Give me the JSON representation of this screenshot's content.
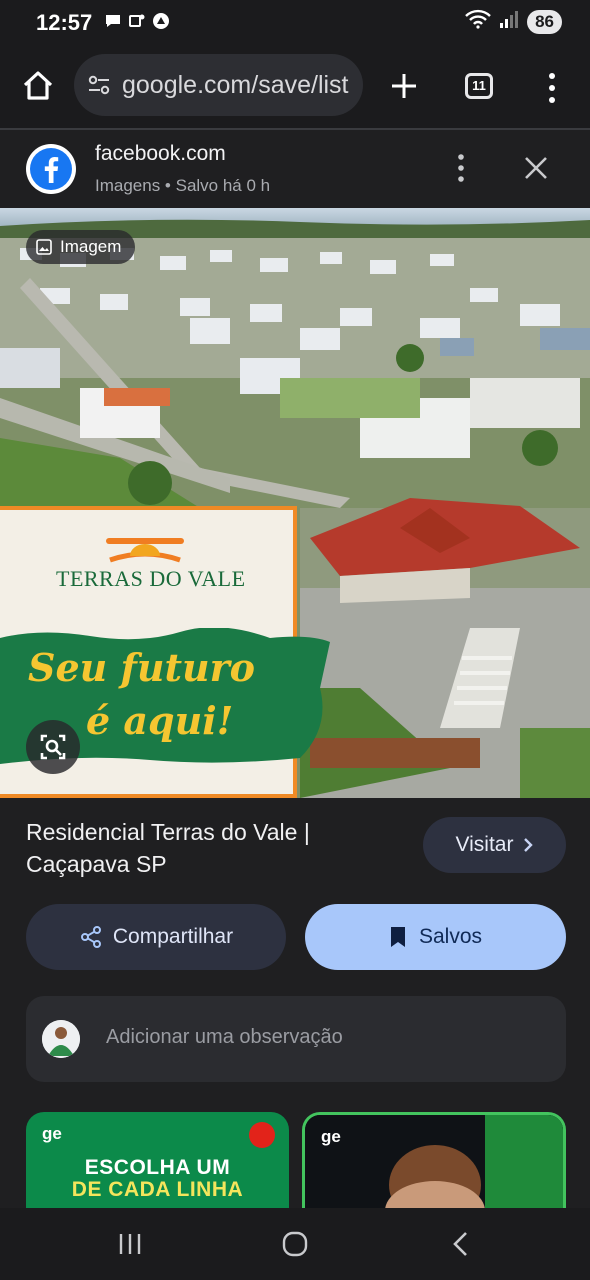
{
  "status_bar": {
    "time": "12:57",
    "battery": "86",
    "icons": [
      "chat-bubble-icon",
      "teams-icon",
      "app-icon",
      "wifi-icon",
      "signal-icon"
    ]
  },
  "browser": {
    "url": "google.com/save/list",
    "tab_count": "11"
  },
  "source": {
    "name": "facebook.com",
    "subtitle": "Imagens • Salvo há 0 h"
  },
  "image": {
    "chip_label": "Imagem",
    "brand": "TERRAS DO VALE",
    "slogan_line1": "Seu futuro",
    "slogan_line2": "é aqui!"
  },
  "item": {
    "title": "Residencial Terras do Vale | Caçapava SP",
    "visit_label": "Visitar",
    "share_label": "Compartilhar",
    "saved_label": "Salvos",
    "note_placeholder": "Adicionar uma observação"
  },
  "cards": [
    {
      "logo": "ge",
      "line1": "ESCOLHA UM",
      "line2": "DE CADA LINHA"
    },
    {
      "logo": "ge"
    }
  ],
  "colors": {
    "background": "#1f1f21",
    "accent_button": "#a8c7fa",
    "tonal_button": "#2d3140",
    "facebook_blue": "#1877f2"
  }
}
